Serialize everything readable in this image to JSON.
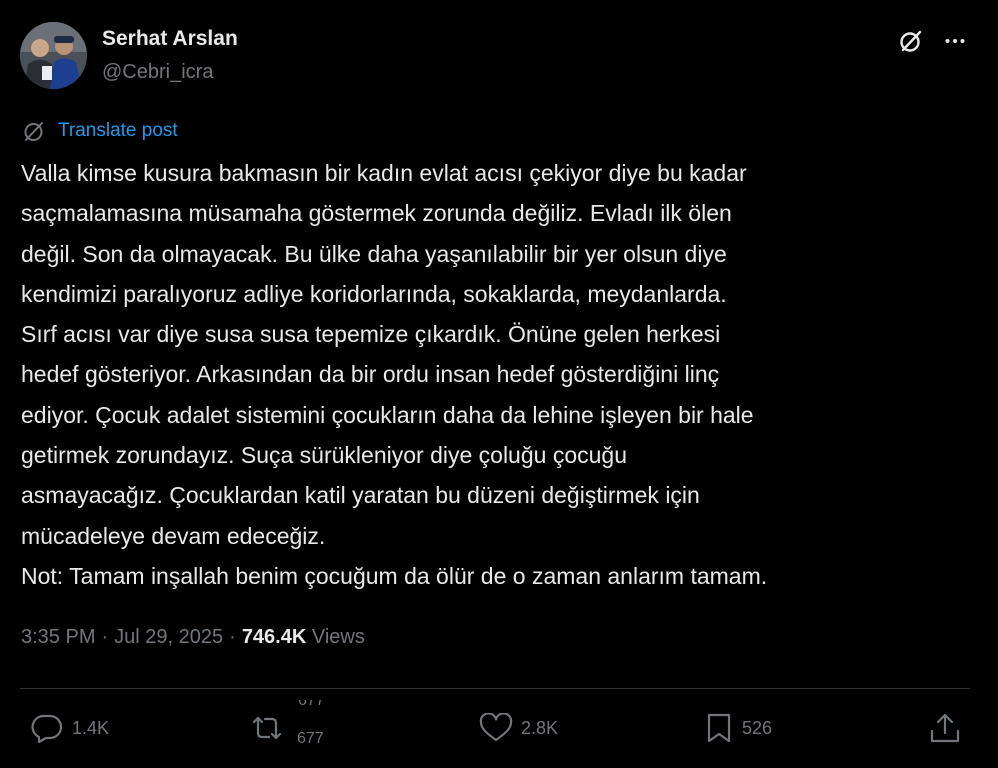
{
  "author": {
    "display_name": "Serhat Arslan",
    "handle": "@Cebri_icra"
  },
  "translate_label": "Translate post",
  "tweet_lines": [
    "Valla kimse kusura bakmasın bir kadın evlat acısı çekiyor diye bu kadar",
    "saçmalamasına müsamaha göstermek zorunda değiliz. Evladı ilk ölen",
    "değil. Son da olmayacak. Bu ülke daha yaşanılabilir bir yer olsun diye",
    "kendimizi paralıyoruz adliye koridorlarında, sokaklarda, meydanlarda.",
    "Sırf acısı var diye susa susa tepemize çıkardık. Önüne gelen herkesi",
    "hedef gösteriyor. Arkasından da bir ordu insan hedef gösterdiğini linç",
    "ediyor. Çocuk adalet sistemini çocukların daha da lehine işleyen bir hale",
    "getirmek zorundayız. Suça sürükleniyor diye çoluğu çocuğu",
    "asmayacağız. Çocuklardan katil yaratan bu düzeni değiştirmek için",
    "mücadeleye devam edeceğiz.",
    "Not: Tamam inşallah benim çocuğum da ölür de o zaman anlarım tamam."
  ],
  "meta": {
    "time": "3:35 PM",
    "separator": "·",
    "date": "Jul 29, 2025",
    "views_count": "746.4K",
    "views_label": "Views"
  },
  "actions": {
    "replies": "1.4K",
    "reposts": "677",
    "likes": "2.8K",
    "bookmarks": "526"
  },
  "icons": {
    "grok": "grok-icon",
    "more": "more-icon",
    "translate": "translate-icon",
    "reply": "reply-icon",
    "repost": "repost-icon",
    "like": "heart-icon",
    "bookmark": "bookmark-icon",
    "share": "share-icon"
  },
  "colors": {
    "background": "#000000",
    "text": "#e7e9ea",
    "secondary": "#71767b",
    "link": "#1d9bf0",
    "divider": "#2f3336"
  }
}
